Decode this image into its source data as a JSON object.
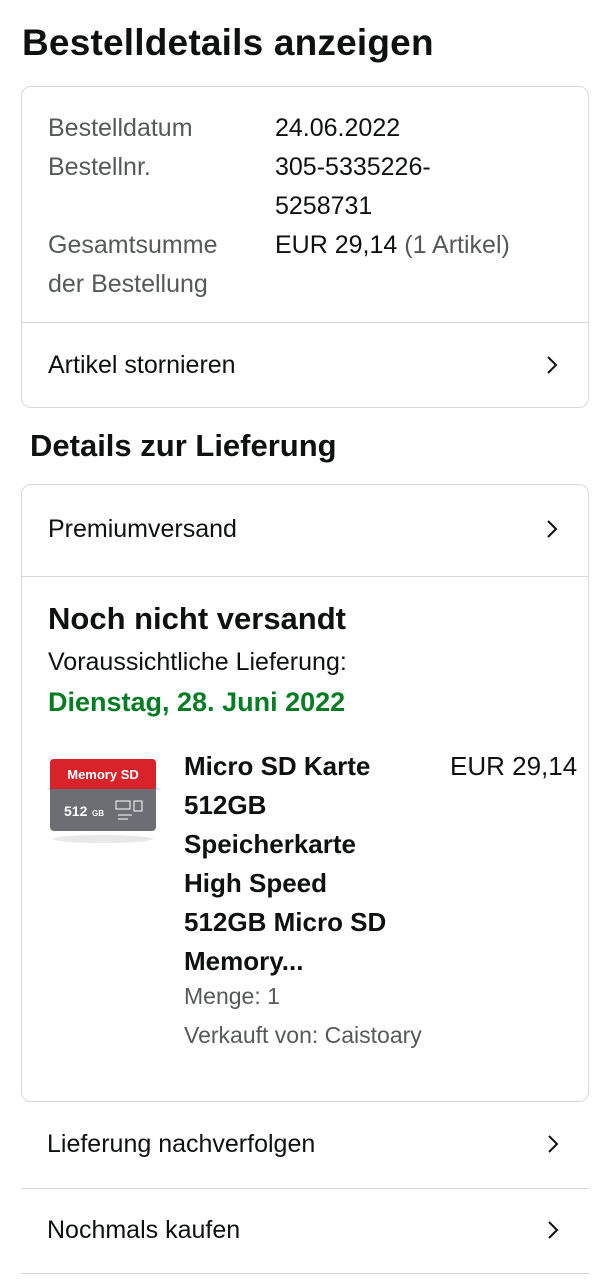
{
  "page": {
    "title": "Bestelldetails anzeigen"
  },
  "summary": {
    "order_date_label": "Bestelldatum",
    "order_date_value": "24.06.2022",
    "order_no_label": "Bestellnr.",
    "order_no_value_line1": "305-5335226-",
    "order_no_value_line2": "5258731",
    "total_label_line1": "Gesamtsumme",
    "total_label_line2": "der Bestellung",
    "total_value": "EUR 29,14",
    "total_items": "(1 Artikel)",
    "cancel_label": "Artikel stornieren"
  },
  "delivery": {
    "section_title": "Details zur Lieferung",
    "shipping_method": "Premiumversand",
    "status_title": "Noch nicht versandt",
    "estimate_label": "Voraussichtliche Lieferung:",
    "estimate_date": "Dienstag, 28. Juni 2022",
    "product": {
      "title_lines": [
        "Micro SD Karte",
        "512GB",
        "Speicherkarte",
        "High Speed",
        "512GB Micro SD",
        "Memory..."
      ],
      "price": "EUR 29,14",
      "quantity": "Menge: 1",
      "seller": "Verkauft von: Caistoary",
      "image_brand_text": "Memory SD",
      "image_capacity": "512",
      "image_capacity_unit": "GB"
    }
  },
  "actions": {
    "track_label": "Lieferung nachverfolgen",
    "buy_again_label": "Nochmals kaufen"
  },
  "colors": {
    "green": "#067d23",
    "border": "#d5d9d9",
    "muted": "#565959",
    "card_red": "#d8232a",
    "card_gray": "#6b6e73"
  },
  "icons": {
    "chevron": "chevron-right-icon"
  }
}
